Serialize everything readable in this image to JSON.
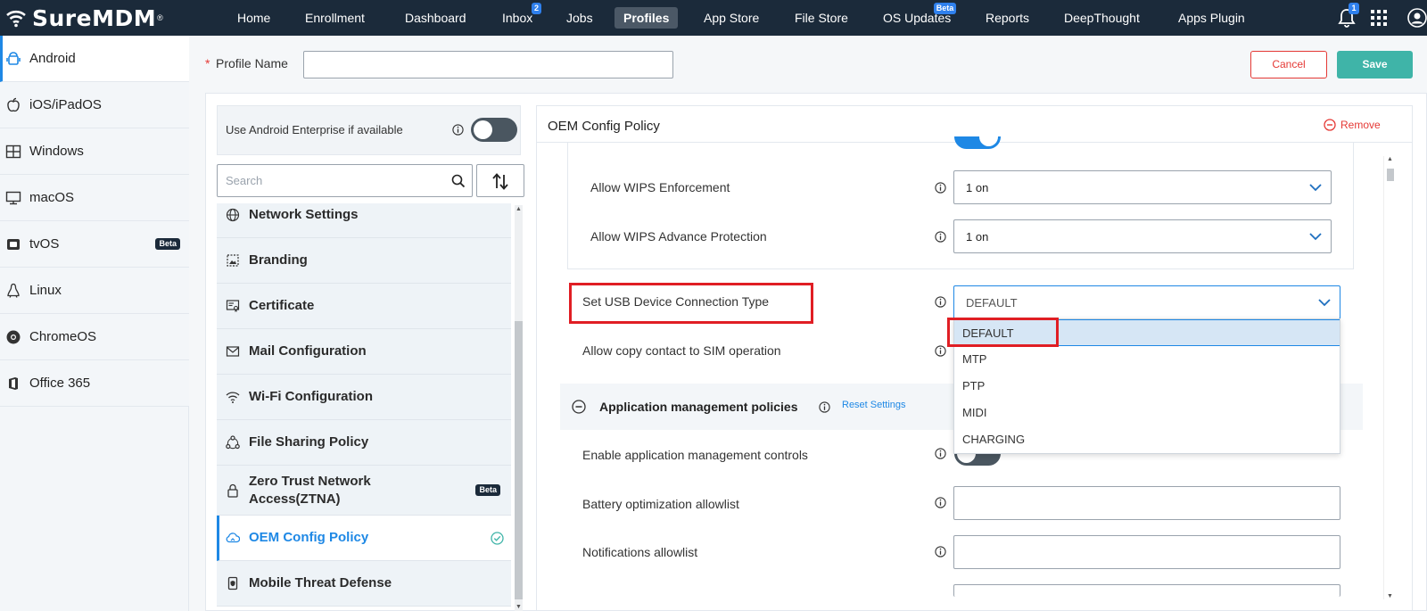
{
  "brand": {
    "name": "SureMDM",
    "reg": "®"
  },
  "nav": {
    "home": "Home",
    "enrollment": "Enrollment",
    "dashboard": "Dashboard",
    "inbox": "Inbox",
    "inbox_badge": "2",
    "jobs": "Jobs",
    "profiles": "Profiles",
    "app_store": "App Store",
    "file_store": "File Store",
    "os_updates": "OS Updates",
    "os_updates_badge": "Beta",
    "reports": "Reports",
    "deepthought": "DeepThought",
    "apps_plugin": "Apps Plugin",
    "notification_badge": "1"
  },
  "os_list": [
    {
      "label": "Android",
      "icon": "android-icon"
    },
    {
      "label": "iOS/iPadOS",
      "icon": "apple-icon"
    },
    {
      "label": "Windows",
      "icon": "windows-icon"
    },
    {
      "label": "macOS",
      "icon": "monitor-icon"
    },
    {
      "label": "tvOS",
      "icon": "tv-icon",
      "badge": "Beta"
    },
    {
      "label": "Linux",
      "icon": "linux-icon"
    },
    {
      "label": "ChromeOS",
      "icon": "chrome-icon"
    },
    {
      "label": "Office 365",
      "icon": "office-icon"
    }
  ],
  "header": {
    "profile_name_label": "Profile Name",
    "profile_name_value": "",
    "cancel": "Cancel",
    "save": "Save"
  },
  "policy_panel": {
    "android_enterprise_label": "Use Android Enterprise if available",
    "android_enterprise_on": false,
    "search_placeholder": "Search",
    "items": [
      {
        "label": "Network Settings",
        "icon": "globe-icon"
      },
      {
        "label": "Branding",
        "icon": "image-icon"
      },
      {
        "label": "Certificate",
        "icon": "certificate-icon"
      },
      {
        "label": "Mail Configuration",
        "icon": "mail-icon"
      },
      {
        "label": "Wi-Fi Configuration",
        "icon": "wifi-icon"
      },
      {
        "label": "File Sharing Policy",
        "icon": "share-icon"
      },
      {
        "label": "Zero Trust Network Access(ZTNA)",
        "icon": "lock-icon",
        "badge": "Beta"
      },
      {
        "label": "OEM Config Policy",
        "icon": "cloud-icon",
        "active": true,
        "configured": true
      },
      {
        "label": "Mobile Threat Defense",
        "icon": "phone-shield-icon"
      }
    ]
  },
  "config": {
    "title": "OEM Config Policy",
    "remove": "Remove",
    "rows": {
      "wips_enforcement": {
        "label": "Allow WIPS Enforcement",
        "value": "1 on"
      },
      "wips_advance": {
        "label": "Allow WIPS Advance Protection",
        "value": "1 on"
      },
      "usb_type": {
        "label": "Set USB Device Connection Type",
        "value": "DEFAULT"
      },
      "copy_contact": {
        "label": "Allow copy contact to SIM operation"
      }
    },
    "usb_options": [
      "DEFAULT",
      "MTP",
      "PTP",
      "MIDI",
      "CHARGING"
    ],
    "app_section": {
      "title": "Application management policies",
      "reset": "Reset Settings",
      "rows": {
        "enable_controls": {
          "label": "Enable application management controls",
          "on": false
        },
        "battery_allowlist": {
          "label": "Battery optimization allowlist",
          "value": ""
        },
        "notifications_allowlist": {
          "label": "Notifications allowlist",
          "value": ""
        }
      }
    }
  },
  "colors": {
    "topbar": "#1b2a3a",
    "accent": "#1e88e5",
    "save": "#3fb4a8",
    "danger": "#e53935",
    "highlight": "#e01e24"
  }
}
